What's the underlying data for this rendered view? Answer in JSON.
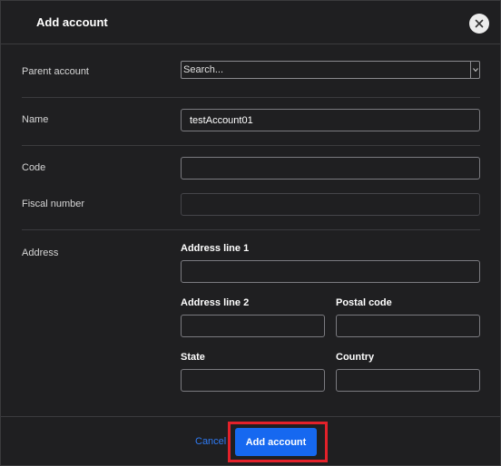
{
  "dialog": {
    "title": "Add account",
    "close_icon": "close-icon"
  },
  "fields": {
    "parent_account": {
      "label": "Parent account",
      "placeholder": "Search..."
    },
    "name": {
      "label": "Name",
      "value": "testAccount01"
    },
    "code": {
      "label": "Code",
      "value": ""
    },
    "fiscal_number": {
      "label": "Fiscal number",
      "value": ""
    },
    "address": {
      "label": "Address",
      "line1": {
        "label": "Address line 1",
        "value": ""
      },
      "line2": {
        "label": "Address line 2",
        "value": ""
      },
      "postal_code": {
        "label": "Postal code",
        "value": ""
      },
      "state": {
        "label": "State",
        "value": ""
      },
      "country": {
        "label": "Country",
        "value": ""
      }
    }
  },
  "footer": {
    "cancel_label": "Cancel",
    "submit_label": "Add account"
  },
  "colors": {
    "background": "#1f1f21",
    "accent": "#1668f0",
    "link": "#2f7bf5",
    "highlight": "#e3212a"
  }
}
